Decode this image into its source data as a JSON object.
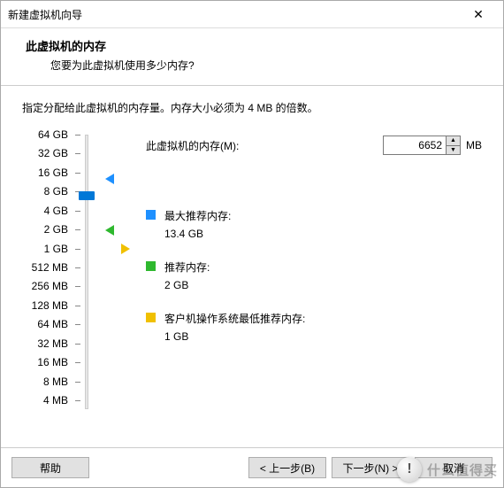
{
  "window": {
    "title": "新建虚拟机向导",
    "close_glyph": "✕"
  },
  "header": {
    "title": "此虚拟机的内存",
    "subtitle": "您要为此虚拟机使用多少内存?"
  },
  "instruction": "指定分配给此虚拟机的内存量。内存大小必须为 4 MB 的倍数。",
  "memory": {
    "label": "此虚拟机的内存(M):",
    "value": "6652",
    "unit": "MB"
  },
  "slider": {
    "ticks": [
      "64 GB",
      "32 GB",
      "16 GB",
      "8 GB",
      "4 GB",
      "2 GB",
      "1 GB",
      "512 MB",
      "256 MB",
      "128 MB",
      "64 MB",
      "32 MB",
      "16 MB",
      "8 MB",
      "4 MB"
    ],
    "handle_pos_pct": 23,
    "markers": {
      "max": {
        "pos_pct": 16.5,
        "color": "#1e90ff"
      },
      "rec": {
        "pos_pct": 36,
        "color": "#2eb82e"
      },
      "min": {
        "pos_pct": 43,
        "color": "#f0c000"
      }
    }
  },
  "recommendations": {
    "max": {
      "label": "最大推荐内存:",
      "value": "13.4 GB",
      "color": "#1e90ff"
    },
    "rec": {
      "label": "推荐内存:",
      "value": "2 GB",
      "color": "#2eb82e"
    },
    "min": {
      "label": "客户机操作系统最低推荐内存:",
      "value": "1 GB",
      "color": "#f0c000"
    }
  },
  "footer": {
    "help": "帮助",
    "back": "< 上一步(B)",
    "next": "下一步(N) >",
    "cancel": "取消"
  },
  "watermark": {
    "glyph": "!",
    "text": "什么值得买"
  }
}
